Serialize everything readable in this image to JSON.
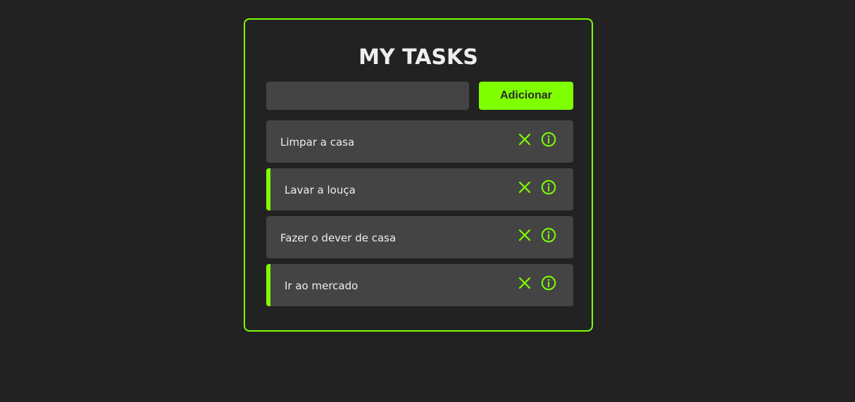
{
  "header": {
    "title": "MY TASKS"
  },
  "form": {
    "input_value": "",
    "input_placeholder": "",
    "add_button_label": "Adicionar"
  },
  "tasks": [
    {
      "label": "Limpar a casa",
      "completed": false
    },
    {
      "label": "Lavar a louça",
      "completed": true
    },
    {
      "label": "Fazer o dever de casa",
      "completed": false
    },
    {
      "label": "Ir ao mercado",
      "completed": true
    }
  ],
  "icons": {
    "remove": "close-icon",
    "details": "info-icon"
  },
  "colors": {
    "accent": "#7fff00",
    "background": "#222222",
    "card": "#444444",
    "text": "#eeeeee"
  }
}
